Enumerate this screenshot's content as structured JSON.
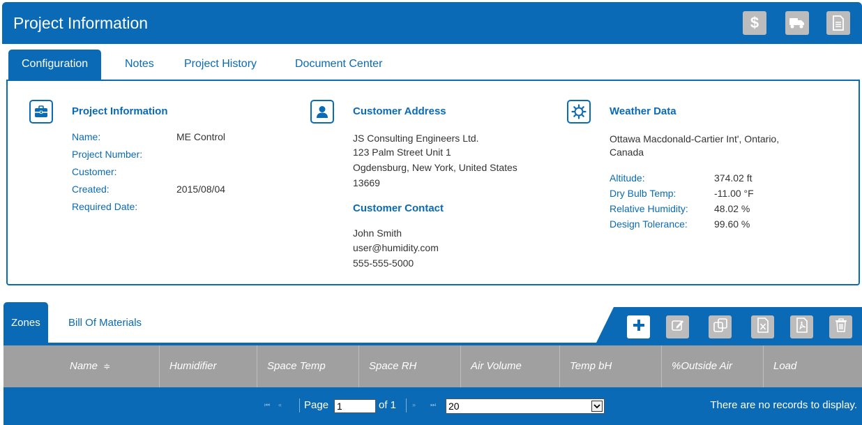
{
  "header": {
    "title": "Project Information",
    "buttons": [
      {
        "icon": "dollar-icon",
        "glyph": "$"
      },
      {
        "icon": "truck-icon"
      },
      {
        "icon": "document-icon"
      }
    ]
  },
  "tabs": [
    {
      "label": "Configuration",
      "active": true
    },
    {
      "label": "Notes"
    },
    {
      "label": "Project History"
    },
    {
      "label": "Document Center"
    }
  ],
  "project_info": {
    "title": "Project Information",
    "icon": "briefcase-icon",
    "name_label": "Name:",
    "name_value": "ME Control",
    "number_label": "Project Number:",
    "customer_label": "Customer:",
    "created_label": "Created:",
    "created_value": "2015/08/04",
    "required_label": "Required Date:"
  },
  "customer_address": {
    "title": "Customer Address",
    "icon": "person-icon",
    "line1": "JS Consulting Engineers Ltd.",
    "line2": "123 Palm Street Unit 1",
    "line3": "Ogdensburg, New York, United States",
    "line4": "13669"
  },
  "customer_contact": {
    "title": "Customer Contact",
    "name": "John Smith",
    "email": "user@humidity.com",
    "phone": "555-555-5000"
  },
  "weather": {
    "title": "Weather Data",
    "icon": "sun-icon",
    "location_line1": "Ottawa Macdonald-Cartier Int', Ontario,",
    "location_line2": "Canada",
    "altitude_label": "Altitude:",
    "altitude_value": "374.02 ft",
    "drybulb_label": "Dry Bulb Temp:",
    "drybulb_value": "-11.00 °F",
    "rh_label": "Relative Humidity:",
    "rh_value": "48.02 %",
    "tolerance_label": "Design Tolerance:",
    "tolerance_value": "99.60 %"
  },
  "lower_tabs": [
    {
      "label": "Zones",
      "active": true
    },
    {
      "label": "Bill Of Materials"
    }
  ],
  "toolbar": [
    {
      "icon": "plus-icon"
    },
    {
      "icon": "edit-icon"
    },
    {
      "icon": "copy-icon"
    },
    {
      "icon": "excel-icon"
    },
    {
      "icon": "pdf-icon"
    },
    {
      "icon": "trash-icon"
    }
  ],
  "grid": {
    "columns": [
      "Name",
      "Humidifier",
      "Space Temp",
      "Space RH",
      "Air Volume",
      "Temp bH",
      "%Outside Air",
      "Load"
    ],
    "sort_indicator": "≑"
  },
  "pager": {
    "page_label": "Page",
    "page_value": "1",
    "of_label": "of 1",
    "page_size": "20",
    "empty_message": "There are no records to display."
  },
  "colors": {
    "primary": "#0a6ab5",
    "header_gray": "#a0a0a0",
    "button_gray": "#bcbcbc"
  }
}
